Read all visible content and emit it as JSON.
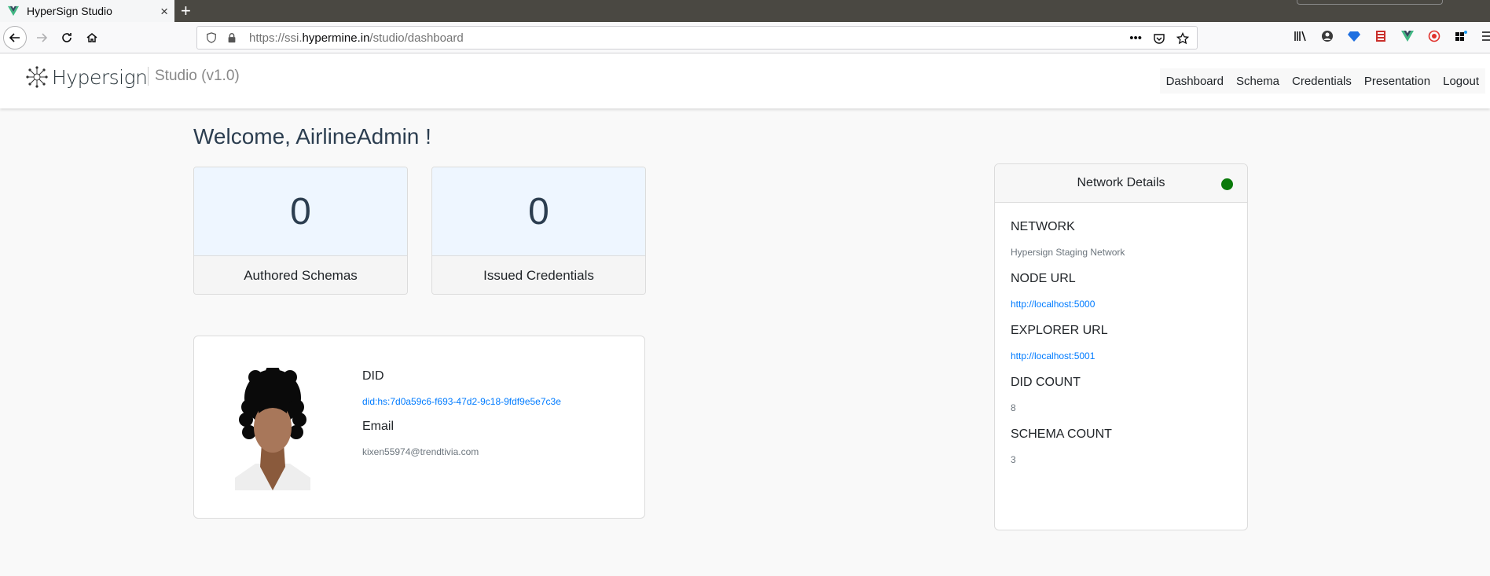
{
  "browser": {
    "tab_title": "HyperSign Studio",
    "tab_close": "×",
    "new_tab": "+",
    "url_prefix": "https://ssi.",
    "url_domain": "hypermine.in",
    "url_path": "/studio/dashboard",
    "url_more": "•••"
  },
  "header": {
    "brand": "Hypersign",
    "studio_title": "Studio (v1.0)",
    "nav": [
      "Dashboard",
      "Schema",
      "Credentials",
      "Presentation",
      "Logout"
    ]
  },
  "main": {
    "welcome": "Welcome, AirlineAdmin !",
    "stats": [
      {
        "count": "0",
        "label": "Authored Schemas"
      },
      {
        "count": "0",
        "label": "Issued Credentials"
      }
    ],
    "profile": {
      "did_label": "DID",
      "did_value": "did:hs:7d0a59c6-f693-47d2-9c18-9fdf9e5e7c3e",
      "email_label": "Email",
      "email_value": "kixen55974@trendtivia.com"
    }
  },
  "network": {
    "title": "Network Details",
    "status_color": "#0a7a0a",
    "network_label": "NETWORK",
    "network_value": "Hypersign Staging Network",
    "node_url_label": "NODE URL",
    "node_url_value": "http://localhost:5000",
    "explorer_url_label": "EXPLORER URL",
    "explorer_url_value": "http://localhost:5001",
    "did_count_label": "DID COUNT",
    "did_count_value": "8",
    "schema_count_label": "SCHEMA COUNT",
    "schema_count_value": "3"
  },
  "colors": {
    "accent": "#007bff",
    "stat_bg": "#eef6ff",
    "text": "#2c3e50"
  }
}
